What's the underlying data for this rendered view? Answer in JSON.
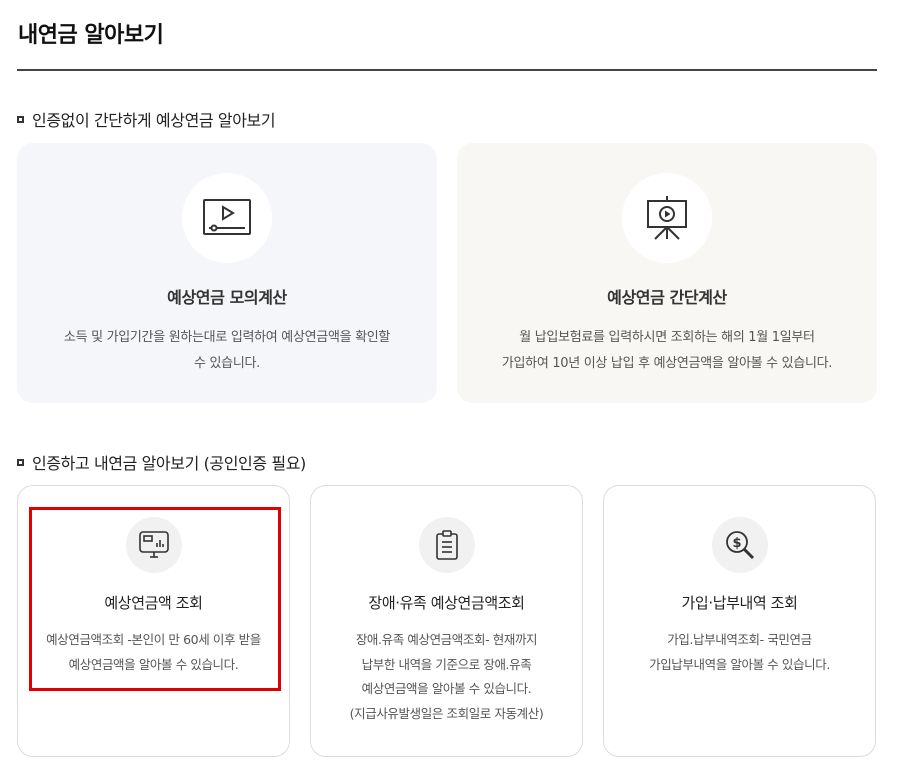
{
  "header": {
    "title": "내연금 알아보기"
  },
  "section_no_auth": {
    "title": "인증없이 간단하게 예상연금 알아보기",
    "cards": [
      {
        "icon": "video-play-icon",
        "title": "예상연금 모의계산",
        "desc_lines": [
          "소득 및 가입기간을 원하는대로 입력하여 예상연금액을 확인할",
          "수 있습니다."
        ]
      },
      {
        "icon": "presentation-board-icon",
        "title": "예상연금 간단계산",
        "desc_lines": [
          "월 납입보험료를 입력하시면 조회하는 해의 1월 1일부터",
          "가입하여 10년 이상 납입 후 예상연금액을 알아볼 수 있습니다."
        ]
      }
    ]
  },
  "section_auth": {
    "title": "인증하고 내연금 알아보기 (공인인증 필요)",
    "cards": [
      {
        "icon": "monitor-chart-icon",
        "title": "예상연금액 조회",
        "desc_lines": [
          "예상연금액조회 -본인이 만 60세 이후 받을",
          "예상연금액을 알아볼 수 있습니다."
        ]
      },
      {
        "icon": "clipboard-icon",
        "title": "장애·유족 예상연금액조회",
        "desc_lines": [
          "장애.유족 예상연금액조회- 현재까지",
          "납부한 내역을 기준으로 장애.유족",
          "예상연금액을 알아볼 수 있습니다.",
          "(지급사유발생일은 조회일로 자동계산)"
        ]
      },
      {
        "icon": "dollar-magnifier-icon",
        "title": "가입·납부내역 조회",
        "desc_lines": [
          "가입.납부내역조회- 국민연금",
          "가입납부내역을 알아볼 수 있습니다."
        ]
      }
    ]
  },
  "colors": {
    "highlight": "#e00000",
    "card_blue": "#f4f6f9",
    "card_beige": "#f9f7f4"
  }
}
